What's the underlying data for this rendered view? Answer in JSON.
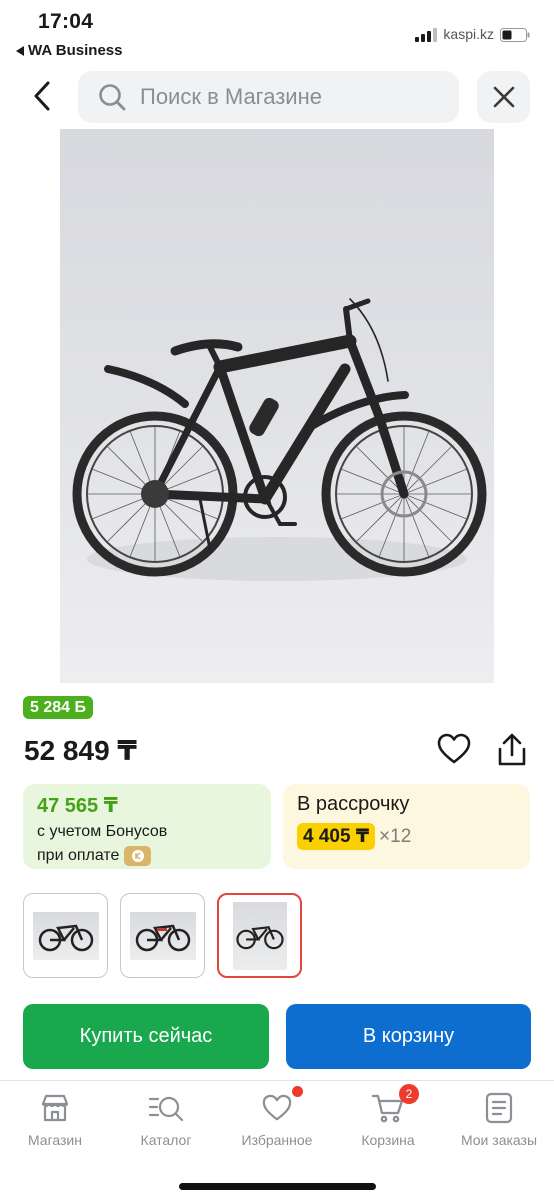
{
  "status_bar": {
    "time": "17:04",
    "back_app": "WA Business",
    "url": "kaspi.kz"
  },
  "search": {
    "placeholder": "Поиск в Магазине"
  },
  "product": {
    "bonus_badge": "5 284 Б",
    "price": "52 849 ₸"
  },
  "bonus_card": {
    "amount": "47 565 ₸",
    "line1": "с учетом Бонусов",
    "line2": "при оплате"
  },
  "credit_card": {
    "title": "В рассрочку",
    "monthly": "4 405 ₸",
    "months": "×12"
  },
  "thumbnails": {
    "count": 3,
    "selected_index": 2
  },
  "actions": {
    "buy_now": "Купить сейчас",
    "add_to_cart": "В корзину"
  },
  "bottom_nav": {
    "items": [
      {
        "label": "Магазин",
        "icon": "shop-icon"
      },
      {
        "label": "Каталог",
        "icon": "catalog-search-icon"
      },
      {
        "label": "Избранное",
        "icon": "heart-icon"
      },
      {
        "label": "Корзина",
        "icon": "cart-icon"
      },
      {
        "label": "Мои заказы",
        "icon": "orders-icon"
      }
    ],
    "cart_count": "2"
  },
  "colors": {
    "bonus_green": "#4caf1d",
    "buy_green": "#19a84e",
    "cart_blue": "#0e6ecf",
    "installment_yellow": "#fbd000",
    "badge_red": "#ee3b2d"
  }
}
